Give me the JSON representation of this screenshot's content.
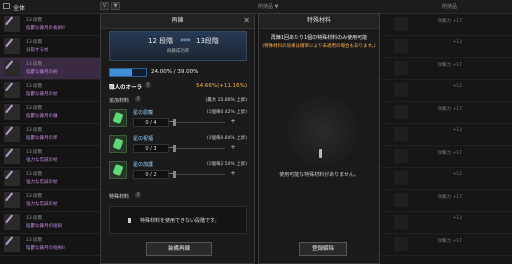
{
  "topbar": {
    "title": "全体",
    "tab1": "V",
    "tab2": "▼",
    "center_text": "所持品 ▼",
    "right_text": "所持品"
  },
  "left_items": [
    {
      "line1": "13 段階",
      "line2": "陰鬱な錬月の長剣II",
      "highlight": false
    },
    {
      "line1": "13 段階",
      "line2": "分裂する杖",
      "highlight": false
    },
    {
      "line1": "13 段階",
      "line2": "陰鬱な錬月の剣",
      "highlight": true
    },
    {
      "line1": "13 段階",
      "line2": "陰鬱な錬月の杖",
      "highlight": false
    },
    {
      "line1": "13 段階",
      "line2": "陰鬱な錬月の鎌",
      "highlight": false
    },
    {
      "line1": "13 段階",
      "line2": "陰鬱な錬月の斧",
      "highlight": false
    },
    {
      "line1": "13 段階",
      "line2": "強力な忠誠の杖",
      "highlight": false
    },
    {
      "line1": "13 段階",
      "line2": "強力な忠誠の杖",
      "highlight": false
    },
    {
      "line1": "13 段階",
      "line2": "強力な忠誠の杖",
      "highlight": false
    },
    {
      "line1": "13 段階",
      "line2": "陰鬱な錬月の短剣",
      "highlight": false
    },
    {
      "line1": "13 段階",
      "line2": "陰鬱な錬月の短剣II",
      "highlight": false
    }
  ],
  "right_items": [
    "攻撃力 +17",
    "+12",
    "攻撃力 +17",
    "+12",
    "攻撃力 +17",
    "+12",
    "攻撃力 +17",
    "+12",
    "攻撃力 +17",
    "+12",
    "攻撃力 +17"
  ],
  "main_panel": {
    "title": "再錬",
    "stage_current": "12 段階",
    "stage_arrow": "»»»",
    "stage_next": "13段階",
    "stage_sub": "再錬成功率",
    "rate_text": "24.00% / 39.00%",
    "rate_fill": 0.615,
    "aura_label": "職人のオーラ",
    "aura_value": "54.66%(+11.16%)",
    "addmat_label": "追加材料",
    "addmat_note": "(最大 15.00% 上昇)",
    "materials": [
      {
        "name": "星の恩寵",
        "note": "(1個毎0.42% 上昇)",
        "count": "0 / 4"
      },
      {
        "name": "星の祝福",
        "note": "(1個毎0.84% 上昇)",
        "count": "0 / 3"
      },
      {
        "name": "星の加護",
        "note": "(1個毎2.50% 上昇)",
        "count": "0 / 2"
      }
    ],
    "special_label": "特殊材料",
    "special_msg": "特殊材料を使用できない段階です。",
    "button": "装備再錬"
  },
  "side_panel": {
    "title": "特殊材料",
    "desc1": "再錬1回あたり1個の特殊材料のみ使用可能",
    "desc2": "(特殊材料の効果は確率により未適用の場合もあります。)",
    "empty_msg": "使用可能な特殊材料がありません。",
    "button": "登録解除"
  },
  "icons": {
    "help": "question-icon",
    "close": "close-icon",
    "gem": "gem-icon",
    "warning": "exclamation-icon"
  }
}
